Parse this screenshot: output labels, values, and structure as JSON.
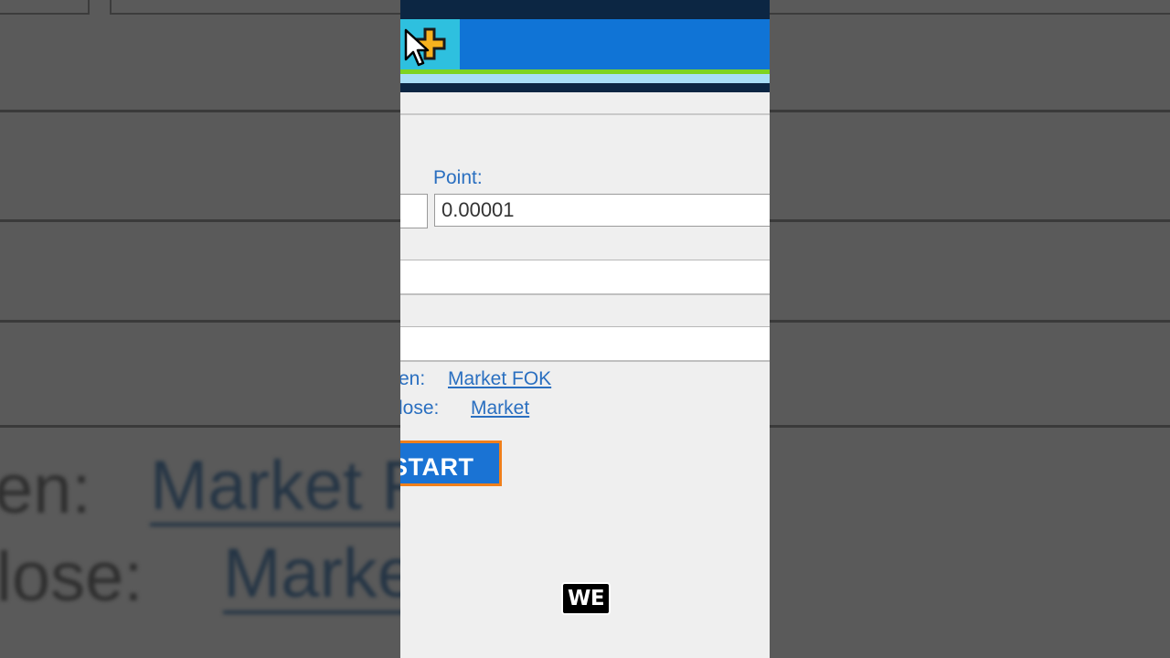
{
  "app": {
    "point_label": "Point:",
    "point_value": "0.00001",
    "open_label": "en:",
    "open_value": "Market FOK",
    "close_label": "lose:",
    "close_value": "Market",
    "start_label": "START"
  },
  "background": {
    "open_label": "en:",
    "open_value": "Market F",
    "close_label": "lose:",
    "close_value": "Marke"
  },
  "caption": "WE",
  "colors": {
    "title_bar": "#0c2643",
    "toolbar": "#1074d6",
    "accent_teal": "#2ec0df",
    "accent_green": "#7ed321",
    "link": "#2a6fc0",
    "start_button": "#1a73d4",
    "start_border": "#f07f1a"
  },
  "icons": {
    "toolbar_tool": "plus-icon",
    "pointer": "mouse-cursor-icon"
  }
}
